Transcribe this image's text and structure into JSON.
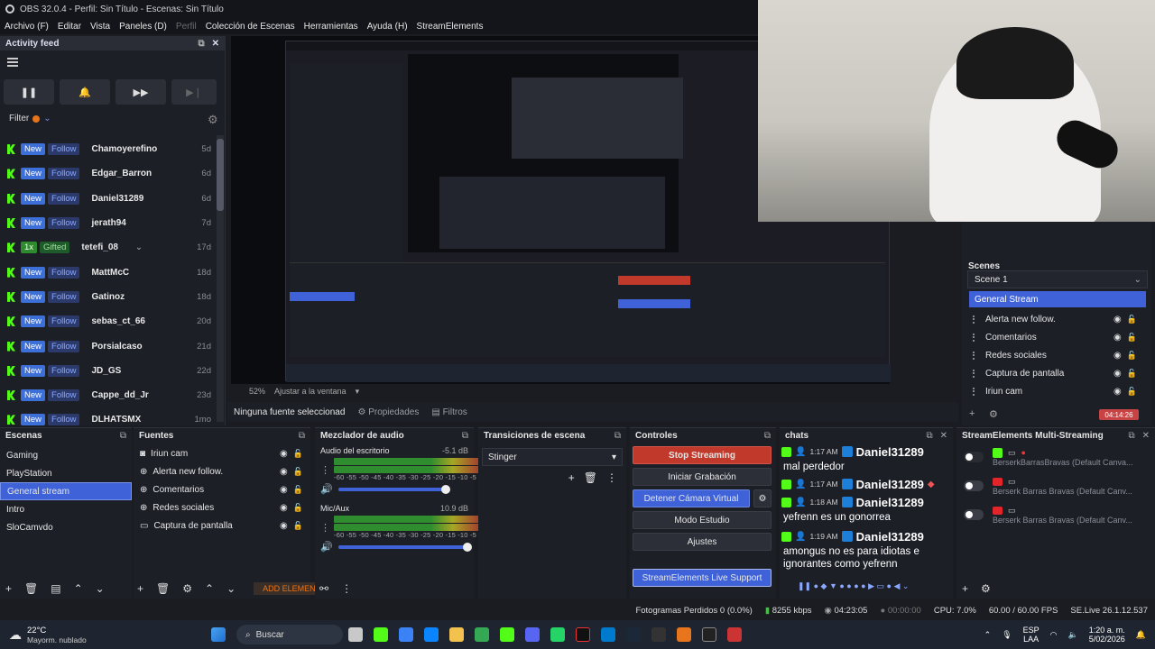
{
  "window": {
    "title": "OBS 32.0.4 - Perfil: Sin Título - Escenas: Sin Título"
  },
  "menu": [
    "Archivo (F)",
    "Editar",
    "Vista",
    "Paneles (D)",
    "Perfil",
    "Colección de Escenas",
    "Herramientas",
    "Ayuda (H)",
    "StreamElements"
  ],
  "activity_feed": {
    "title": "Activity feed",
    "filter_label": "Filter",
    "items": [
      {
        "badge1": "New",
        "badge2": "Follow",
        "name": "Chamoyerefino",
        "age": "5d"
      },
      {
        "badge1": "New",
        "badge2": "Follow",
        "name": "Edgar_Barron",
        "age": "6d"
      },
      {
        "badge1": "New",
        "badge2": "Follow",
        "name": "Daniel31289",
        "age": "6d"
      },
      {
        "badge1": "New",
        "badge2": "Follow",
        "name": "jerath94",
        "age": "7d"
      },
      {
        "badge1": "1x",
        "badge2": "Gifted",
        "name": "tetefi_08",
        "age": "17d"
      },
      {
        "badge1": "New",
        "badge2": "Follow",
        "name": "MattMcC",
        "age": "18d"
      },
      {
        "badge1": "New",
        "badge2": "Follow",
        "name": "Gatinoz",
        "age": "18d"
      },
      {
        "badge1": "New",
        "badge2": "Follow",
        "name": "sebas_ct_66",
        "age": "20d"
      },
      {
        "badge1": "New",
        "badge2": "Follow",
        "name": "Porsialcaso",
        "age": "21d"
      },
      {
        "badge1": "New",
        "badge2": "Follow",
        "name": "JD_GS",
        "age": "22d"
      },
      {
        "badge1": "New",
        "badge2": "Follow",
        "name": "Cappe_dd_Jr",
        "age": "23d"
      },
      {
        "badge1": "New",
        "badge2": "Follow",
        "name": "DLHATSMX",
        "age": "1mo"
      }
    ]
  },
  "preview_status": {
    "zoom": "52%",
    "fit": "Ajustar a la ventana"
  },
  "props_bar": {
    "no_source": "Ninguna fuente seleccionad",
    "properties": "Propiedades",
    "filters": "Filtros"
  },
  "right_scenes": {
    "title": "Scenes",
    "selected": "Scene 1",
    "active": "General Stream",
    "sources": [
      "Alerta new follow.",
      "Comentarios",
      "Redes sociales",
      "Captura de pantalla",
      "Iriun cam"
    ],
    "timer": "04:14:26"
  },
  "scenes_dock": {
    "title": "Escenas",
    "items": [
      "Gaming",
      "PlayStation",
      "General stream",
      "Intro",
      "SloCamvdo"
    ],
    "selected_index": 2
  },
  "sources_dock": {
    "title": "Fuentes",
    "items": [
      "Iriun cam",
      "Alerta new follow.",
      "Comentarios",
      "Redes sociales",
      "Captura de pantalla"
    ],
    "add_element": "ADD ELEMENT"
  },
  "mixer": {
    "title": "Mezclador de audio",
    "channels": [
      {
        "name": "Audio del escritorio",
        "db": "-5.1 dB",
        "level": 0.78
      },
      {
        "name": "Mic/Aux",
        "db": "10.9 dB",
        "level": 0.9
      }
    ],
    "ticks": "-60 -55 -50 -45 -40 -35 -30 -25 -20 -15 -10 -5 0"
  },
  "transitions": {
    "title": "Transiciones de escena",
    "selected": "Stinger"
  },
  "controls": {
    "title": "Controles",
    "stop_streaming": "Stop Streaming",
    "start_recording": "Iniciar Grabación",
    "stop_virtual_cam": "Detener Cámara Virtual",
    "studio_mode": "Modo Estudio",
    "settings": "Ajustes",
    "se_support": "StreamElements Live Support"
  },
  "chats": {
    "title": "chats",
    "messages": [
      {
        "time": "1:17 AM",
        "user": "Daniel31289",
        "msg": "mal perdedor"
      },
      {
        "time": "1:17 AM",
        "user": "Daniel31289",
        "msg": ""
      },
      {
        "time": "1:18 AM",
        "user": "Daniel31289",
        "msg": "yefrenn es un gonorrea"
      },
      {
        "time": "1:19 AM",
        "user": "Daniel31289",
        "msg": "amongus no es para idiotas e ignorantes como yefrenn"
      }
    ]
  },
  "multistream": {
    "title": "StreamElements Multi-Streaming",
    "rows": [
      "BerserkBarrasBravas (Default Canva...",
      "Berserk Barras Bravas (Default Canv...",
      "Berserk Barras Bravas (Default Canv..."
    ]
  },
  "statusbar": {
    "dropped": "Fotogramas Perdidos 0 (0.0%)",
    "kbps": "8255 kbps",
    "stream_time": "04:23:05",
    "rec_time": "00:00:00",
    "cpu": "CPU: 7.0%",
    "fps": "60.00 / 60.00 FPS",
    "se_live": "SE.Live 26.1.12.537"
  },
  "taskbar": {
    "temp": "22°C",
    "weather": "Mayorm. nublado",
    "search": "Buscar",
    "lang1": "ESP",
    "lang2": "LAA",
    "time": "1:20 a. m.",
    "date": "5/02/2026"
  }
}
